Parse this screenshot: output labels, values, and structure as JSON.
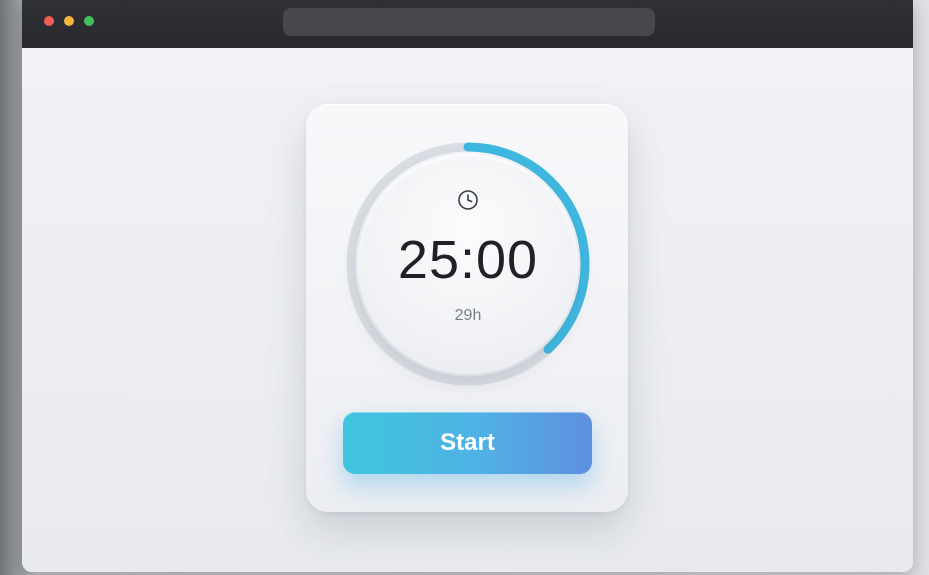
{
  "window": {
    "traffic_lights": [
      {
        "name": "close",
        "color": "#ee5e57"
      },
      {
        "name": "minimize",
        "color": "#f4b63a"
      },
      {
        "name": "zoom",
        "color": "#44c05a"
      }
    ],
    "address_bar": {
      "value": ""
    }
  },
  "timer": {
    "icon": "clock-icon",
    "time": "25:00",
    "subtext": "29h",
    "progress_fraction": 0.38,
    "accent_color": "#3fb8e0",
    "track_color": "#dadde3"
  },
  "actions": {
    "start_label": "Start",
    "start_gradient": [
      "#3fc6de",
      "#5f8fe0"
    ]
  }
}
